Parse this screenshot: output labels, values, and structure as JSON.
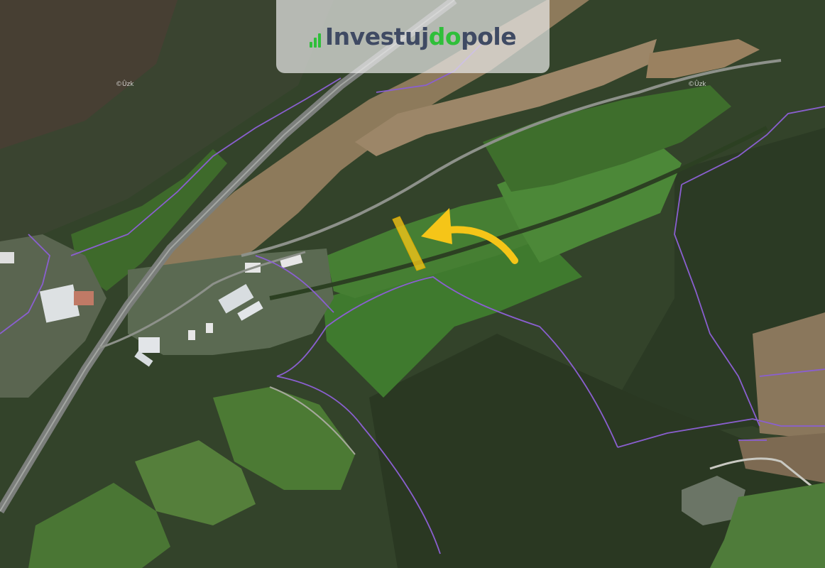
{
  "logo": {
    "part1": "Investuj",
    "part2": "do",
    "part3": "pole",
    "color_primary": "#3f4a63",
    "color_accent": "#2fbf3a"
  },
  "watermarks": [
    "©Ûzk",
    "©Ûzk"
  ],
  "map": {
    "type": "satellite",
    "parcel_boundary_color": "#8a5fd0",
    "highlight_color": "#f5c518",
    "arrow_color": "#f5c518",
    "arrow_direction": "pointing left toward highlighted parcel"
  }
}
